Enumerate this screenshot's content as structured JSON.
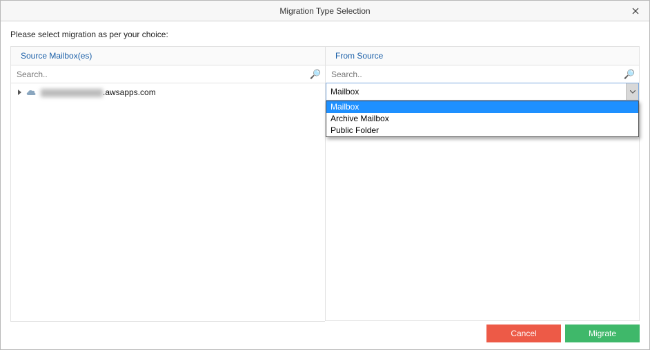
{
  "window": {
    "title": "Migration Type Selection"
  },
  "instruction": "Please select migration as per your choice:",
  "left": {
    "header": "Source Mailbox(es)",
    "search_placeholder": "Search..",
    "tree_item_suffix": ".awsapps.com"
  },
  "right": {
    "header": "From Source",
    "search_placeholder": "Search..",
    "select_value": "Mailbox",
    "options": [
      "Mailbox",
      "Archive Mailbox",
      "Public Folder"
    ]
  },
  "footer": {
    "cancel": "Cancel",
    "migrate": "Migrate"
  }
}
